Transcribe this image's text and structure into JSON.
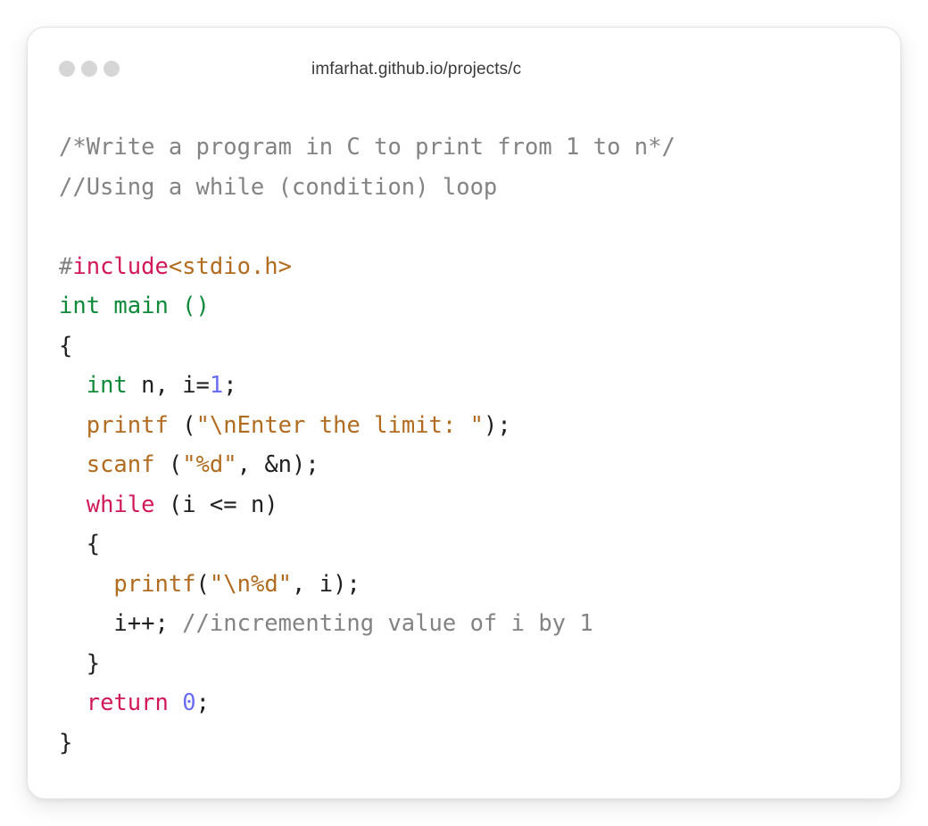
{
  "window": {
    "url": "imfarhat.github.io/projects/c"
  },
  "code_lines": [
    [
      {
        "t": "/*Write a program in C to print from 1 to n*/",
        "c": "comment"
      }
    ],
    [
      {
        "t": "//Using a while (condition) loop",
        "c": "comment"
      }
    ],
    [],
    [
      {
        "t": "#",
        "c": "hash"
      },
      {
        "t": "include",
        "c": "include"
      },
      {
        "t": "<stdio.h>",
        "c": "header"
      }
    ],
    [
      {
        "t": "int main ()",
        "c": "type"
      }
    ],
    [
      {
        "t": "{",
        "c": "plain"
      }
    ],
    [
      {
        "t": "  ",
        "c": "plain"
      },
      {
        "t": "int",
        "c": "type"
      },
      {
        "t": " n, i=",
        "c": "plain"
      },
      {
        "t": "1",
        "c": "number"
      },
      {
        "t": ";",
        "c": "plain"
      }
    ],
    [
      {
        "t": "  ",
        "c": "plain"
      },
      {
        "t": "printf",
        "c": "func"
      },
      {
        "t": " (",
        "c": "plain"
      },
      {
        "t": "\"\\nEnter the limit: \"",
        "c": "string"
      },
      {
        "t": ");",
        "c": "plain"
      }
    ],
    [
      {
        "t": "  ",
        "c": "plain"
      },
      {
        "t": "scanf",
        "c": "func"
      },
      {
        "t": " (",
        "c": "plain"
      },
      {
        "t": "\"%d\"",
        "c": "string"
      },
      {
        "t": ", &n);",
        "c": "plain"
      }
    ],
    [
      {
        "t": "  ",
        "c": "plain"
      },
      {
        "t": "while",
        "c": "keyword"
      },
      {
        "t": " (i <= n)",
        "c": "plain"
      }
    ],
    [
      {
        "t": "  {",
        "c": "plain"
      }
    ],
    [
      {
        "t": "    ",
        "c": "plain"
      },
      {
        "t": "printf",
        "c": "func"
      },
      {
        "t": "(",
        "c": "plain"
      },
      {
        "t": "\"\\n%d\"",
        "c": "string"
      },
      {
        "t": ", i);",
        "c": "plain"
      }
    ],
    [
      {
        "t": "    i++; ",
        "c": "plain"
      },
      {
        "t": "//incrementing value of i by 1",
        "c": "comment"
      }
    ],
    [
      {
        "t": "  }",
        "c": "plain"
      }
    ],
    [
      {
        "t": "  ",
        "c": "plain"
      },
      {
        "t": "return",
        "c": "keyword"
      },
      {
        "t": " ",
        "c": "plain"
      },
      {
        "t": "0",
        "c": "number"
      },
      {
        "t": ";",
        "c": "plain"
      }
    ],
    [
      {
        "t": "}",
        "c": "plain"
      }
    ]
  ]
}
